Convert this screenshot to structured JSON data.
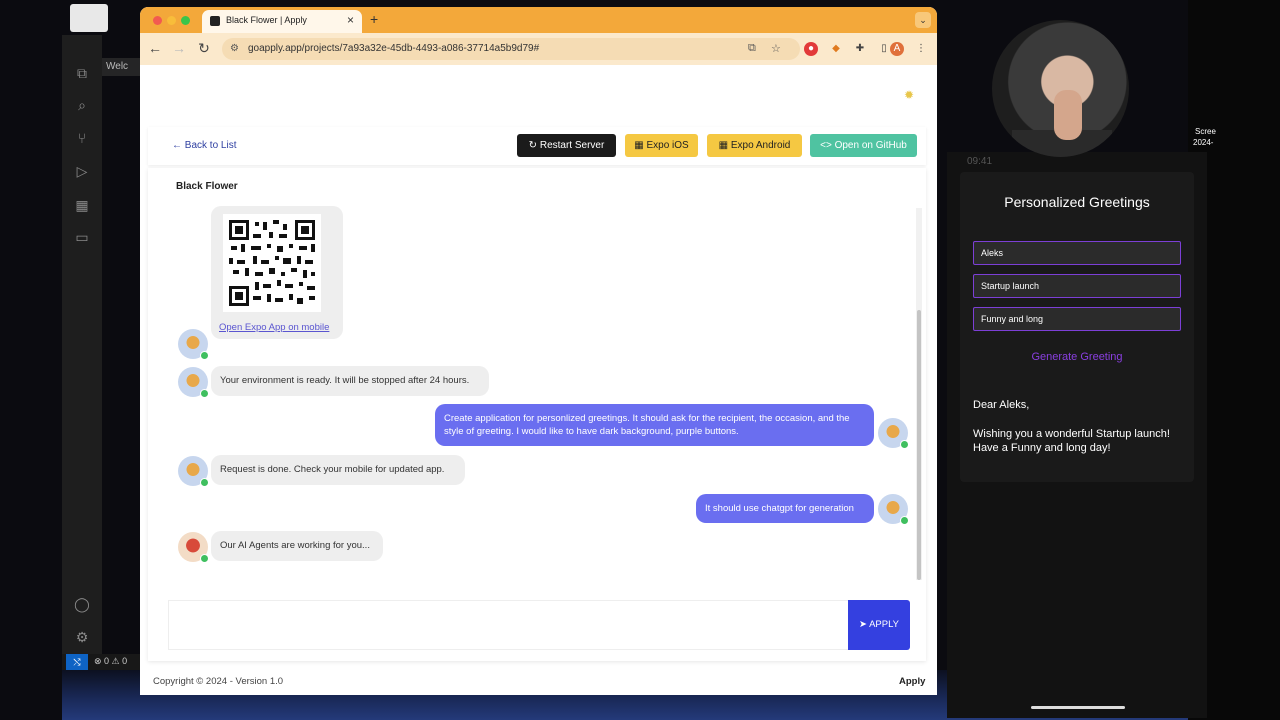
{
  "browser": {
    "tab_title": "Black Flower | Apply",
    "url": "goapply.app/projects/7a93a32e-45db-4493-a086-37714a5b9d79#"
  },
  "page": {
    "back_label": "Back to List",
    "restart_label": "Restart Server",
    "expo_ios_label": "Expo iOS",
    "expo_android_label": "Expo Android",
    "github_label": "Open on GitHub",
    "project_title": "Black Flower",
    "apply_label": "APPLY",
    "footer_copy": "Copyright © 2024 - Version 1.0",
    "footer_brand": "Apply"
  },
  "chat": {
    "qr_link": "Open Expo App on mobile",
    "msg_env_ready": "Your environment is ready. It will be stopped after 24 hours.",
    "msg_user_1": "Create application for personlized greetings. It should ask for the recipient, the occasion, and the style of greeting. I would like to have dark background, purple buttons.",
    "msg_request_done": "Request is done. Check your mobile for updated app.",
    "msg_user_2": "It should use chatgpt for generation",
    "msg_agents": "Our AI Agents are working for you..."
  },
  "phone": {
    "time": "09:41",
    "title": "Personalized Greetings",
    "field_recipient": "Aleks",
    "field_occasion": "Startup launch",
    "field_style": "Funny and long",
    "generate_label": "Generate Greeting",
    "greeting_line1": "Dear Aleks,",
    "greeting_line2": "Wishing you a wonderful Startup launch!",
    "greeting_line3": "Have a Funny and long day!"
  },
  "vscode": {
    "tab_label": "Welc",
    "status_problems": "⊗ 0 ⚠ 0"
  },
  "side": {
    "label_1": "Scree",
    "label_2": "2024-"
  },
  "colors": {
    "tab_bar": "#f3a83a",
    "primary_button": "#3440e0",
    "user_bubble": "#6a6ef0",
    "phone_accent": "#8a3fe0"
  }
}
